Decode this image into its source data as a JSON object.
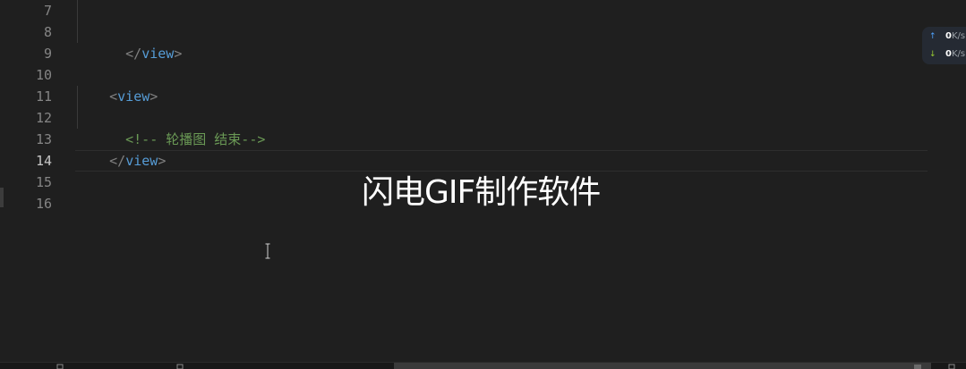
{
  "gutter": {
    "line_numbers": [
      "7",
      "8",
      "9",
      "10",
      "11",
      "12",
      "13",
      "14",
      "15",
      "16"
    ]
  },
  "code": {
    "line8": {
      "open": "</",
      "tag": "view",
      "close": ">"
    },
    "line10": {
      "open": "<",
      "tag": "view",
      "close": ">"
    },
    "line12": {
      "comment": "<!-- 轮播图 结束-->"
    },
    "line13": {
      "open": "</",
      "tag": "view",
      "close": ">"
    }
  },
  "watermark": {
    "text": "闪电GIF制作软件"
  },
  "network_widget": {
    "upload_value": "0",
    "upload_unit": "K/s",
    "download_value": "0",
    "download_unit": "K/s",
    "upload_icon": "arrow-up-icon",
    "download_icon": "arrow-down-icon"
  },
  "colors": {
    "background": "#1f1f1f",
    "line_number": "#858585",
    "tag_name": "#569cd6",
    "tag_bracket": "#808080",
    "comment": "#6a9955"
  }
}
